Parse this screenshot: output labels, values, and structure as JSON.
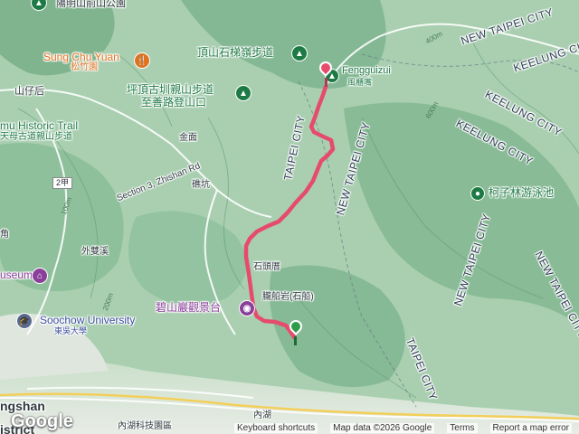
{
  "map": {
    "type": "terrain",
    "colors": {
      "terrain_green": "#9fc7a6",
      "route": "#e64b6e",
      "end_pin": "#e64b6e",
      "start_pin": "#2e9d4a",
      "poi_green": "#1e7a45",
      "poi_orange": "#e0721e",
      "poi_purple": "#8a3f9a"
    }
  },
  "labels": {
    "yangmingshan": "陽明山前山公園",
    "ding_shan": "頂山石梯嶺步道",
    "fengguizui_en": "Fengguizui",
    "fengguizui_zh": "風櫃嘴",
    "sung_chu_yuan_en": "Sung Chu Yuan",
    "sung_chu_yuan_zh": "松竹園",
    "pingding_1": "坪頂古圳親山步道",
    "pingding_2": "至善路登山口",
    "shanzihou": "山仔后",
    "historic_trail": "mu Historic Trail",
    "tianmu_zh": "天母古道親山步道",
    "jinmian": "金面",
    "road_2jia": "2甲",
    "section3": "Section 3, Zhishan Rd",
    "yikeng": "礁坑",
    "waishuangxi": "外雙溪",
    "jiao": "角",
    "useum": "useum",
    "shitouping": "石頭厝",
    "soochow_en": "Soochow University",
    "soochow_zh": "東吳大學",
    "bishanyan": "碧山巖觀景台",
    "chuanchuanyan": "朧船岩(石船)",
    "kezilin": "柯子林游泳池",
    "neihu_tech": "內湖科技園區",
    "neihu": "內湖",
    "gshan": "ngshan",
    "istrict": "istrict"
  },
  "cities": {
    "taipei_top": "TAIPEI CITY",
    "new_taipei_mid": "NEW TAIPEI CITY",
    "new_taipei_tr": "NEW TAIPEI CITY",
    "keelung_1": "KEELUNG CITY",
    "keelung_2": "KEELUNG CITY",
    "keelung_3": "KEELUNG CITY",
    "new_taipei_r": "NEW TAIPEI CITY",
    "new_taipei_low": "NEW TAIPEI CITY",
    "taipei_low": "TAIPEI CITY"
  },
  "elevations": [
    "600m",
    "400m",
    "200m",
    "100m"
  ],
  "footer": {
    "keyboard": "Keyboard shortcuts",
    "mapdata": "Map data ©2026 Google",
    "terms": "Terms",
    "report": "Report a map error",
    "logo": "Google"
  }
}
